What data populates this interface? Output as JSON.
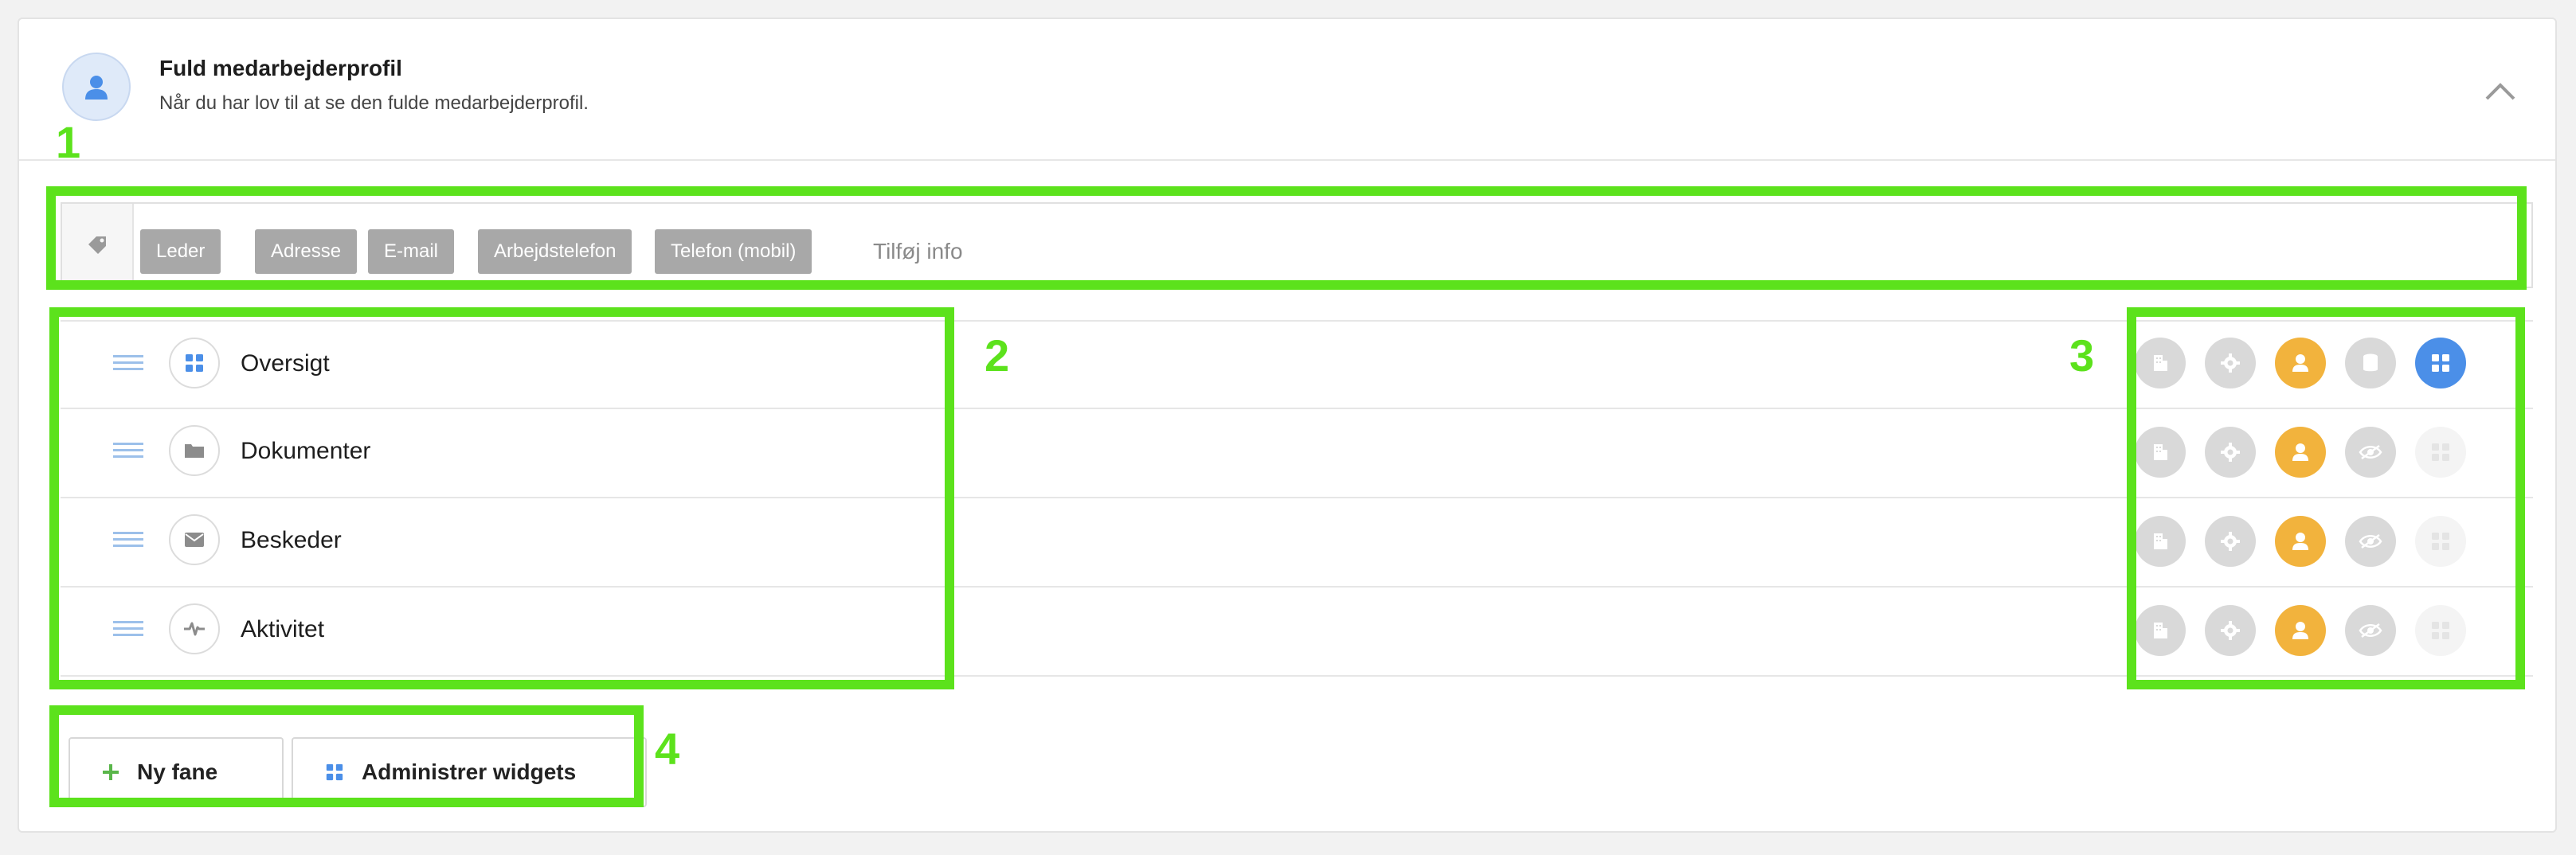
{
  "header": {
    "title": "Fuld medarbejderprofil",
    "subtitle": "Når du har lov til at se den fulde medarbejderprofil.",
    "avatar_icon": "person-icon",
    "collapse_icon": "chevron-up-icon"
  },
  "tags": {
    "icon": "tag-icon",
    "items": [
      "Leder",
      "Adresse",
      "E-mail",
      "Arbejdstelefon",
      "Telefon (mobil)"
    ],
    "add_placeholder": "Tilføj info"
  },
  "tabs": [
    {
      "label": "Oversigt",
      "icon": "grid-icon"
    },
    {
      "label": "Dokumenter",
      "icon": "folder-icon"
    },
    {
      "label": "Beskeder",
      "icon": "envelope-icon"
    },
    {
      "label": "Aktivitet",
      "icon": "activity-icon"
    }
  ],
  "permission_icons": [
    "building-icon",
    "gear-icon",
    "person-icon",
    "eye-icon",
    "grid-icon"
  ],
  "buttons": {
    "new_tab": "Ny fane",
    "manage_widgets": "Administrer widgets"
  },
  "annotations": [
    "1",
    "2",
    "3",
    "4"
  ],
  "colors": {
    "highlight": "#5ce21c",
    "orange": "#f2b33d",
    "blue": "#4b8fe8",
    "tag_gray": "#a8a8a8"
  }
}
